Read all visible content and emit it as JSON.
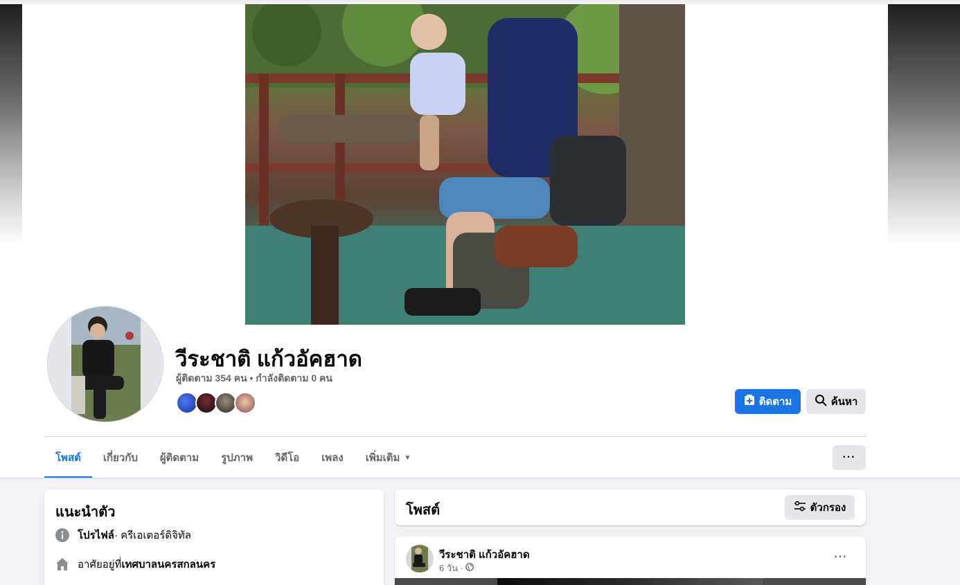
{
  "profile": {
    "name": "วีระชาติ แก้วอัคฮาด",
    "stats": "ผู้ติดตาม 354 คน • กำลังติดตาม 0 คน",
    "follower_avatar_colors": [
      "#2d4fd8",
      "#2a1416",
      "#4a4a3c",
      "#c98a7a"
    ]
  },
  "actions": {
    "follow_label": "ติดตาม",
    "search_label": "ค้นหา",
    "more_label": "···"
  },
  "tabs": [
    {
      "label": "โพสต์"
    },
    {
      "label": "เกี่ยวกับ"
    },
    {
      "label": "ผู้ติดตาม"
    },
    {
      "label": "รูปภาพ"
    },
    {
      "label": "วิดีโอ"
    },
    {
      "label": "เพลง"
    },
    {
      "label": "เพิ่มเติม"
    }
  ],
  "intro": {
    "title": "แนะนำตัว",
    "profile_label": "โปรไฟล์",
    "profile_category": " · ครีเอเตอร์ดิจิทัล",
    "lives_prefix": "อาศัยอยู่ที่ ",
    "lives_place": "เทศบาลนครสกลนคร"
  },
  "posts": {
    "title": "โพสต์",
    "filter_label": "ตัวกรอง",
    "post": {
      "author": "วีระชาติ แก้วอัคฮาด",
      "time": "6 วัน ·",
      "more_label": "···"
    }
  },
  "colors": {
    "accent": "#1b74e4",
    "secondary_button": "#e4e6eb",
    "page_background": "#f0f2f5"
  }
}
